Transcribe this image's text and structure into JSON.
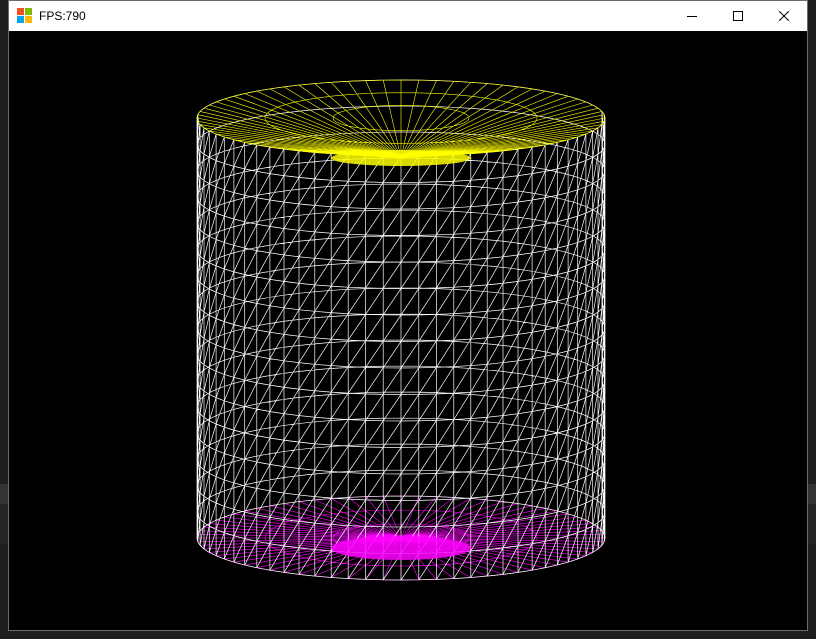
{
  "window": {
    "title": "FPS:790",
    "icon": "app-form-icon",
    "controls": {
      "minimize": "minimize-icon",
      "maximize": "maximize-icon",
      "close": "close-icon"
    }
  },
  "scene": {
    "object": "cylinder",
    "render_mode": "wireframe",
    "background": "#000000",
    "colors": {
      "side": "#ffffff",
      "top_cap": "#ffff00",
      "bottom_cap": "#ff00ff"
    }
  }
}
